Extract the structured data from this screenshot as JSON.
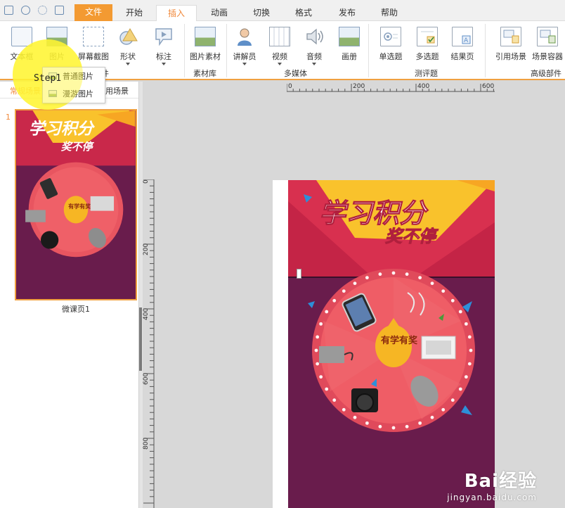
{
  "menu": {
    "tabs": [
      "文件",
      "开始",
      "插入",
      "动画",
      "切换",
      "格式",
      "发布",
      "帮助"
    ],
    "active_tab": "插入"
  },
  "ribbon": {
    "buttons": [
      {
        "label": "文本框",
        "icon": "textbox-icon"
      },
      {
        "label": "图片",
        "icon": "picture-icon"
      },
      {
        "label": "屏幕截图",
        "icon": "screenshot-icon"
      },
      {
        "label": "形状",
        "icon": "shape-icon"
      },
      {
        "label": "标注",
        "icon": "callout-icon"
      },
      {
        "label": "图片素材",
        "icon": "picture-library-icon"
      },
      {
        "label": "讲解员",
        "icon": "presenter-icon"
      },
      {
        "label": "视频",
        "icon": "video-icon"
      },
      {
        "label": "音频",
        "icon": "audio-icon"
      },
      {
        "label": "画册",
        "icon": "album-icon"
      },
      {
        "label": "单选题",
        "icon": "single-choice-icon"
      },
      {
        "label": "多选题",
        "icon": "multi-choice-icon"
      },
      {
        "label": "结果页",
        "icon": "result-page-icon"
      },
      {
        "label": "引用场景",
        "icon": "reference-scene-icon"
      },
      {
        "label": "场景容器",
        "icon": "scene-container-icon"
      }
    ],
    "groups": [
      "件",
      "素材库",
      "多媒体",
      "测评题",
      "高级部件"
    ]
  },
  "picture_dropdown": {
    "items": [
      "普通图片",
      "漫游图片"
    ]
  },
  "step_label": "Step1",
  "left_panel": {
    "tabs": [
      "常规场景",
      "用场景"
    ],
    "slide_number": "1",
    "slide_caption": "微课页1"
  },
  "slide": {
    "title": "学习积分",
    "subtitle": "奖不停",
    "wheel_center": "有学有奖"
  },
  "rulers": {
    "h_labels": [
      "0",
      "200",
      "400",
      "600"
    ],
    "v_labels": [
      "0",
      "200",
      "400",
      "600",
      "800"
    ]
  },
  "watermark": {
    "brand": "Bai经验",
    "url": "jingyan.baidu.com"
  },
  "colors": {
    "accent": "#f0883a",
    "file_tab": "#f39a32",
    "slide_top": "#d8304f",
    "slide_bottom": "#691c4c",
    "wheel": "#ef5561",
    "banner": "#f9c22c"
  }
}
